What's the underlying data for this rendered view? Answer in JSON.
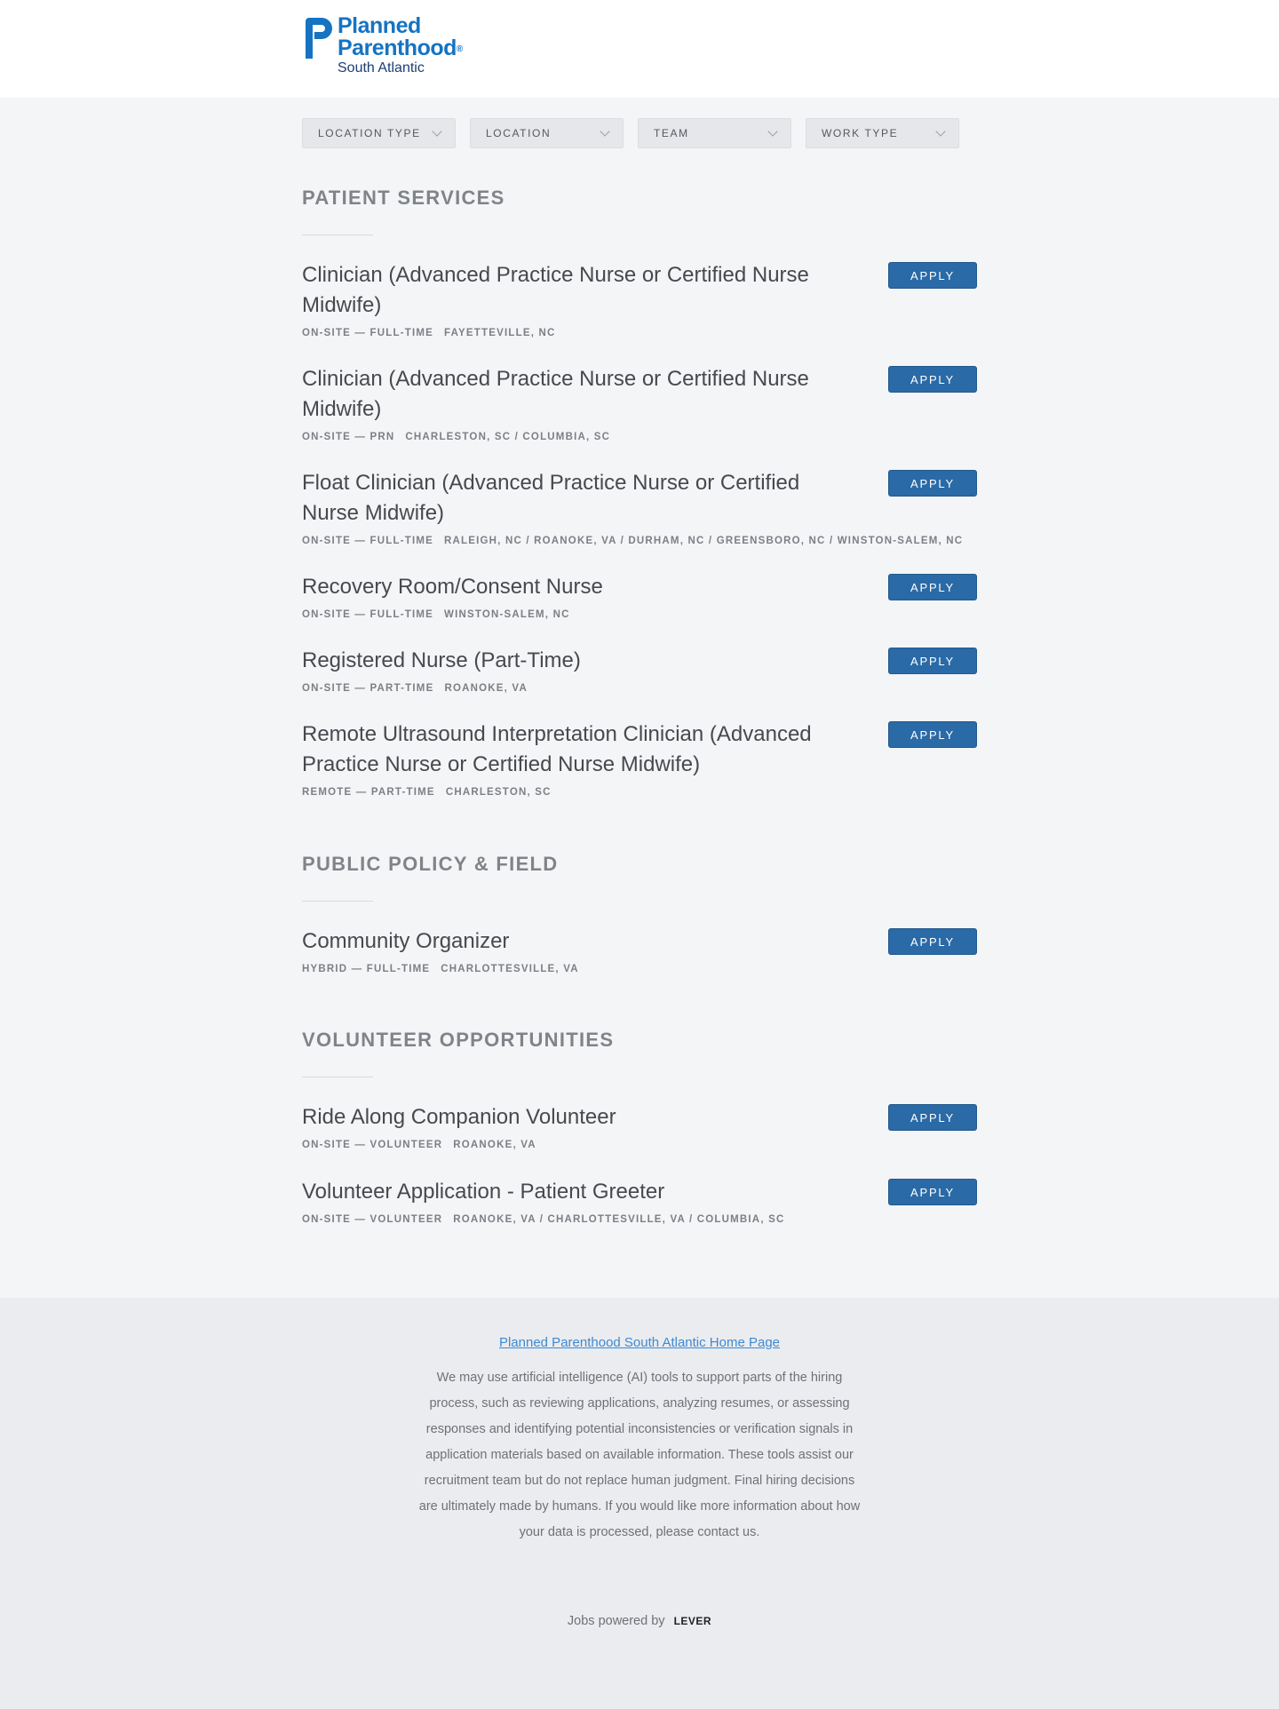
{
  "brand": {
    "line1": "Planned",
    "line2": "Parenthood",
    "registered": "®",
    "line3": "South Atlantic",
    "color": "#1573c2"
  },
  "filters": [
    {
      "label": "LOCATION TYPE",
      "icon": "chevron-down-icon"
    },
    {
      "label": "LOCATION",
      "icon": "chevron-down-icon"
    },
    {
      "label": "TEAM",
      "icon": "chevron-down-icon"
    },
    {
      "label": "WORK TYPE",
      "icon": "chevron-down-icon"
    }
  ],
  "apply_label": "APPLY",
  "groups": [
    {
      "title": "PATIENT SERVICES",
      "postings": [
        {
          "title": "Clinician (Advanced Practice Nurse or Certified Nurse Midwife)",
          "work": "ON-SITE — FULL-TIME",
          "location": "FAYETTEVILLE, NC"
        },
        {
          "title": "Clinician (Advanced Practice Nurse or Certified Nurse Midwife)",
          "work": "ON-SITE — PRN",
          "location": "CHARLESTON, SC / COLUMBIA, SC"
        },
        {
          "title": "Float Clinician (Advanced Practice Nurse or Certified Nurse Midwife)",
          "work": "ON-SITE — FULL-TIME",
          "location": "RALEIGH, NC / ROANOKE, VA / DURHAM, NC / GREENSBORO, NC / WINSTON-SALEM, NC"
        },
        {
          "title": "Recovery Room/Consent Nurse",
          "work": "ON-SITE — FULL-TIME",
          "location": "WINSTON-SALEM, NC"
        },
        {
          "title": "Registered Nurse (Part-Time)",
          "work": "ON-SITE — PART-TIME",
          "location": "ROANOKE, VA"
        },
        {
          "title": "Remote Ultrasound Interpretation Clinician (Advanced Practice Nurse or Certified Nurse Midwife)",
          "work": "REMOTE — PART-TIME",
          "location": "CHARLESTON, SC"
        }
      ]
    },
    {
      "title": "PUBLIC POLICY & FIELD",
      "postings": [
        {
          "title": "Community Organizer",
          "work": "HYBRID — FULL-TIME",
          "location": "CHARLOTTESVILLE, VA"
        }
      ]
    },
    {
      "title": "VOLUNTEER OPPORTUNITIES",
      "postings": [
        {
          "title": "Ride Along Companion Volunteer",
          "work": "ON-SITE — VOLUNTEER",
          "location": "ROANOKE, VA"
        },
        {
          "title": "Volunteer Application - Patient Greeter",
          "work": "ON-SITE — VOLUNTEER",
          "location": "ROANOKE, VA / CHARLOTTESVILLE, VA / COLUMBIA, SC"
        }
      ]
    }
  ],
  "footer": {
    "home_link": "Planned Parenthood South Atlantic Home Page",
    "ai_notice": "We may use artificial intelligence (AI) tools to support parts of the hiring process, such as reviewing applications, analyzing resumes, or assessing responses and identifying potential inconsistencies or verification signals in application materials based on available information. These tools assist our recruitment team but do not replace human judgment. Final hiring decisions are ultimately made by humans. If you would like more information about how your data is processed, please contact us.",
    "powered_prefix": "Jobs powered by",
    "powered_brand": "LEVER"
  },
  "colors": {
    "apply_button": "#2a6aa6",
    "link": "#3d8ad3",
    "background": "#f4f5f7"
  }
}
